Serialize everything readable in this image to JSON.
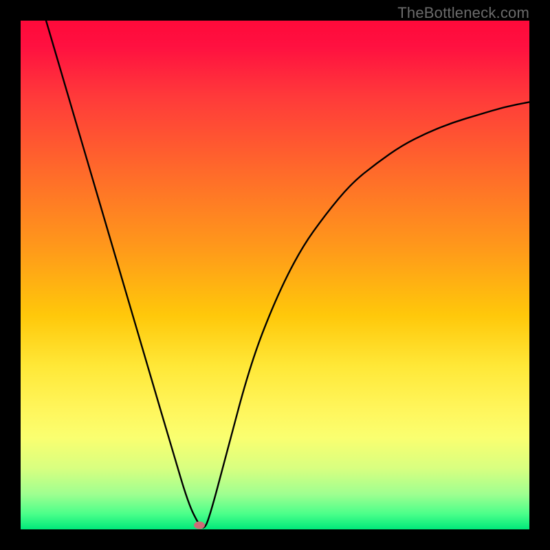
{
  "watermark": "TheBottleneck.com",
  "chart_data": {
    "type": "line",
    "title": "",
    "xlabel": "",
    "ylabel": "",
    "xlim": [
      0,
      100
    ],
    "ylim": [
      0,
      100
    ],
    "grid": false,
    "legend": false,
    "series": [
      {
        "name": "curve",
        "x": [
          5,
          10,
          15,
          20,
          25,
          30,
          33,
          35,
          36,
          37,
          40,
          45,
          50,
          55,
          60,
          65,
          70,
          75,
          80,
          85,
          90,
          95,
          100
        ],
        "values": [
          100,
          83,
          66,
          49,
          32,
          15,
          5,
          1,
          0,
          2,
          13,
          32,
          45,
          55,
          62,
          68,
          72,
          75.5,
          78,
          80,
          81.5,
          83,
          84
        ]
      }
    ],
    "marker": {
      "x": 35.2,
      "y": 0.8,
      "color": "#cc6d77"
    },
    "background_gradient": {
      "type": "vertical",
      "stops": [
        {
          "pos": 0,
          "color": "#ff0a3a"
        },
        {
          "pos": 0.5,
          "color": "#ff9a1a"
        },
        {
          "pos": 0.78,
          "color": "#fff55a"
        },
        {
          "pos": 1.0,
          "color": "#00e87a"
        }
      ]
    }
  }
}
